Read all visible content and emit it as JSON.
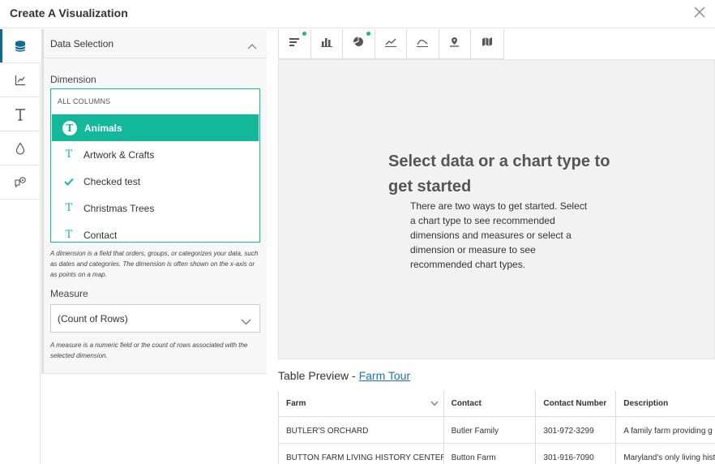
{
  "header": {
    "title": "Create A Visualization"
  },
  "rail": {
    "items": [
      {
        "icon": "database-icon",
        "active": true
      },
      {
        "icon": "axis-chart-icon",
        "active": false
      },
      {
        "icon": "text-icon",
        "active": false
      },
      {
        "icon": "drop-icon",
        "active": false
      },
      {
        "icon": "chat-settings-icon",
        "active": false
      }
    ]
  },
  "panel": {
    "section_title": "Data Selection",
    "dimension_label": "Dimension",
    "group_label": "ALL COLUMNS",
    "dimensions": [
      {
        "label": "Animals",
        "icon": "text-type-icon",
        "selected": true
      },
      {
        "label": "Artwork & Crafts",
        "icon": "text-type-icon",
        "selected": false
      },
      {
        "label": "Checked test",
        "icon": "checkmark-icon",
        "selected": false
      },
      {
        "label": "Christmas Trees",
        "icon": "text-type-icon",
        "selected": false
      },
      {
        "label": "Contact",
        "icon": "text-type-icon",
        "selected": false
      }
    ],
    "dimension_help": "A dimension is a field that orders, groups, or categorizes your data, such as dates and categories. The dimension is often shown on the x-axis or as points on a map.",
    "measure_label": "Measure",
    "measure_value": "(Count of Rows)",
    "measure_help": "A measure is a numeric field or the count of rows associated with the selected dimension."
  },
  "toolbar": {
    "tools": [
      {
        "icon": "bar-horizontal-icon",
        "recommended": true
      },
      {
        "icon": "bar-vertical-icon",
        "recommended": false
      },
      {
        "icon": "pie-chart-icon",
        "recommended": true
      },
      {
        "icon": "line-chart-icon",
        "recommended": false
      },
      {
        "icon": "area-chart-icon",
        "recommended": false
      },
      {
        "icon": "point-map-icon",
        "recommended": false
      },
      {
        "icon": "region-map-icon",
        "recommended": false
      }
    ],
    "accent": "#2bb673"
  },
  "canvas": {
    "headline": "Select data or a chart type to get started",
    "subtext": "There are two ways to get started. Select a chart type to see recommended dimensions and measures or select a dimension or measure to see recommended chart types."
  },
  "table_preview": {
    "prefix": "Table Preview - ",
    "dataset": "Farm Tour",
    "columns": [
      "Farm",
      "Contact",
      "Contact Number",
      "Description"
    ],
    "rows": [
      [
        "BUTLER'S ORCHARD",
        "Butler Family",
        "301-972-3299",
        "A family farm providing g"
      ],
      [
        "BUTTON FARM LIVING HISTORY CENTER",
        "Button Farm",
        "301-916-7090",
        "Maryland's only living hist"
      ]
    ]
  },
  "colors": {
    "accent": "#13b89a",
    "link": "#1a73b8",
    "rail_active": "#0f6b8f"
  }
}
